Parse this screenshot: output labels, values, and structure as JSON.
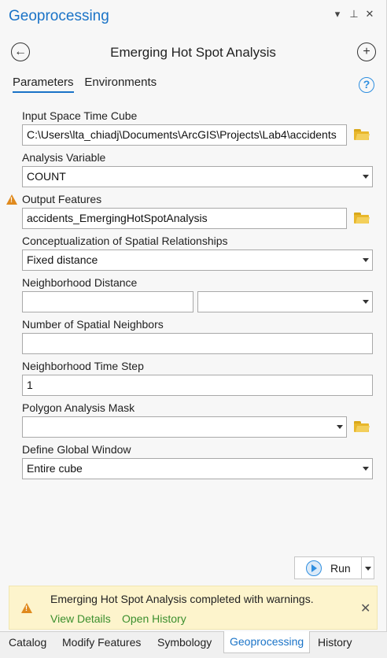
{
  "pane": {
    "title": "Geoprocessing",
    "menu_icon": "▾",
    "pin_icon": "⊥",
    "close_icon": "✕"
  },
  "header": {
    "tool_title": "Emerging Hot Spot Analysis",
    "back_icon": "←",
    "add_icon": "+"
  },
  "tabs": {
    "parameters": "Parameters",
    "environments": "Environments",
    "help": "?"
  },
  "params": {
    "input_cube_label": "Input Space Time Cube",
    "input_cube_value": "C:\\Users\\lta_chiadj\\Documents\\ArcGIS\\Projects\\Lab4\\accidents",
    "analysis_var_label": "Analysis Variable",
    "analysis_var_value": "COUNT",
    "output_features_label": "Output Features",
    "output_features_value": "accidents_EmergingHotSpotAnalysis",
    "concept_label": "Conceptualization of Spatial Relationships",
    "concept_value": "Fixed distance",
    "neigh_dist_label": "Neighborhood Distance",
    "neigh_dist_value": "",
    "neigh_dist_unit": "",
    "spatial_neighbors_label": "Number of Spatial Neighbors",
    "spatial_neighbors_value": "",
    "time_step_label": "Neighborhood Time Step",
    "time_step_value": "1",
    "mask_label": "Polygon Analysis Mask",
    "mask_value": "",
    "global_window_label": "Define Global Window",
    "global_window_value": "Entire cube"
  },
  "run": {
    "label": "Run"
  },
  "message": {
    "text": "Emerging Hot Spot Analysis completed with warnings.",
    "view_details": "View Details",
    "open_history": "Open History",
    "close_icon": "✕",
    "warning_glyph": "!"
  },
  "bottom_tabs": [
    "Catalog",
    "Modify Features",
    "Symbology",
    "Geoprocessing",
    "History"
  ],
  "colors": {
    "accent": "#1a73c7",
    "warning": "#e08a1e",
    "link": "#3b8f2e",
    "message_bg": "#fdf4cc"
  }
}
